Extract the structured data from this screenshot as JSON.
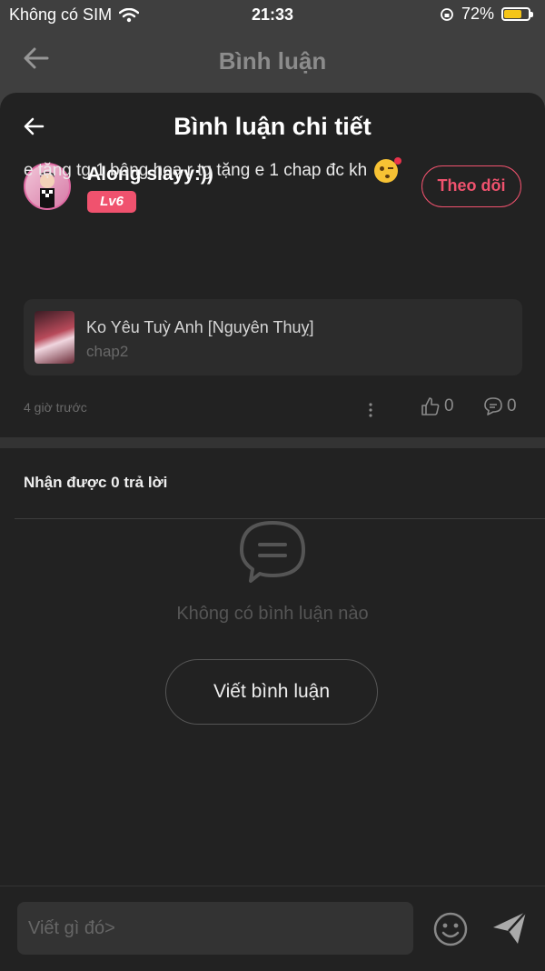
{
  "status_bar": {
    "carrier": "Không có SIM",
    "time": "21:33",
    "battery": "72%",
    "battery_level": 0.72
  },
  "background_header": {
    "title": "Bình luận"
  },
  "sheet": {
    "title": "Bình luận chi tiết"
  },
  "comment": {
    "author": "Along slayy:))",
    "level": "Lv6",
    "follow_label": "Theo dõi",
    "text": "e tặng tg 1 bông hoa r tg tặng e 1 chap đc kh",
    "manga_title": "Ko Yêu Tuỳ Anh [Nguyên Thuỵ]",
    "manga_chapter": "chap2",
    "timestamp": "4 giờ trước",
    "likes": "0",
    "replies": "0"
  },
  "replies_section": {
    "heading": "Nhận được 0 trả lời",
    "empty_text": "Không có bình luận nào",
    "write_button": "Viết bình luận"
  },
  "input": {
    "placeholder": "Viết gì đó>"
  },
  "colors": {
    "accent": "#f0526e",
    "sheet_bg": "#222222",
    "screen_bg": "#3f3f3f"
  }
}
